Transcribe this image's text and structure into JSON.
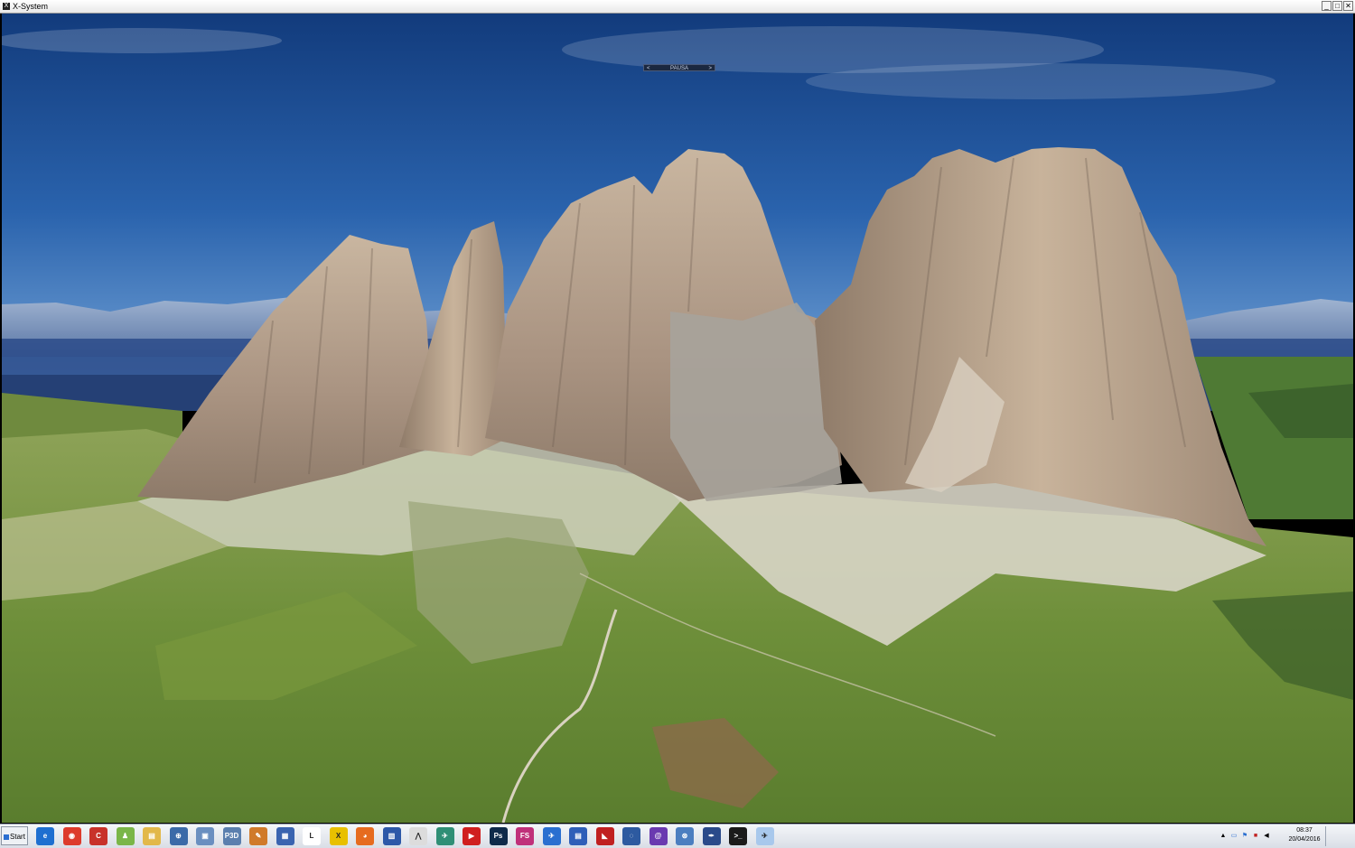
{
  "window": {
    "title": "X-System",
    "minimize_label": "_",
    "maximize_label": "□",
    "close_label": "✕"
  },
  "simulator": {
    "pause_label": "PAUSA",
    "pause_prev": "<",
    "pause_next": ">"
  },
  "taskbar": {
    "start_label": "Start",
    "icons": [
      {
        "name": "internet-explorer-icon",
        "color": "#1e6fd0",
        "glyph": "e"
      },
      {
        "name": "chrome-icon",
        "color": "#dd3b2c",
        "glyph": "◉"
      },
      {
        "name": "ccleaner-icon",
        "color": "#c8322a",
        "glyph": "C"
      },
      {
        "name": "android-icon",
        "color": "#7ab648",
        "glyph": "♟"
      },
      {
        "name": "file-explorer-icon",
        "color": "#e2b84a",
        "glyph": "▤"
      },
      {
        "name": "network-globe-icon",
        "color": "#3b6aa8",
        "glyph": "⊕"
      },
      {
        "name": "window-tool-icon",
        "color": "#6a8fc0",
        "glyph": "▣"
      },
      {
        "name": "p3d-icon",
        "color": "#5b7fae",
        "glyph": "P3D"
      },
      {
        "name": "tools-icon",
        "color": "#d07a2a",
        "glyph": "✎"
      },
      {
        "name": "remote-desktop-icon",
        "color": "#3a64b0",
        "glyph": "▦"
      },
      {
        "name": "document-icon",
        "color": "#ffffff",
        "glyph": "L"
      },
      {
        "name": "xplane-icon",
        "color": "#e8c000",
        "glyph": "X"
      },
      {
        "name": "firefox-icon",
        "color": "#e66b1f",
        "glyph": "◕"
      },
      {
        "name": "settings-window-icon",
        "color": "#2d58a8",
        "glyph": "▥"
      },
      {
        "name": "network-tool-icon",
        "color": "#dcdcdc",
        "glyph": "⋀"
      },
      {
        "name": "airplane-tool-icon",
        "color": "#2f8f76",
        "glyph": "✈"
      },
      {
        "name": "mp3-icon",
        "color": "#d01f1f",
        "glyph": "▶"
      },
      {
        "name": "photoshop-icon",
        "color": "#0e2a4a",
        "glyph": "Ps"
      },
      {
        "name": "fs-icon",
        "color": "#c0307a",
        "glyph": "FS"
      },
      {
        "name": "flight-planner-icon",
        "color": "#2a6fd0",
        "glyph": "✈"
      },
      {
        "name": "folder-window-icon",
        "color": "#2f5fb8",
        "glyph": "▤"
      },
      {
        "name": "vpn-icon",
        "color": "#c02020",
        "glyph": "◣"
      },
      {
        "name": "globe-icon",
        "color": "#2d5aa0",
        "glyph": "◌"
      },
      {
        "name": "spiral-icon",
        "color": "#6a3ab0",
        "glyph": "@"
      },
      {
        "name": "internet-globe-icon",
        "color": "#4b7ec0",
        "glyph": "⊛"
      },
      {
        "name": "editor-icon",
        "color": "#2a4a8a",
        "glyph": "✒"
      },
      {
        "name": "terminal-icon",
        "color": "#1a1a1a",
        "glyph": ">_"
      },
      {
        "name": "xsystem-window-icon",
        "color": "#a8c8ec",
        "glyph": "✈"
      }
    ],
    "clock": {
      "time": "08:37",
      "date": "20/04/2016"
    }
  }
}
